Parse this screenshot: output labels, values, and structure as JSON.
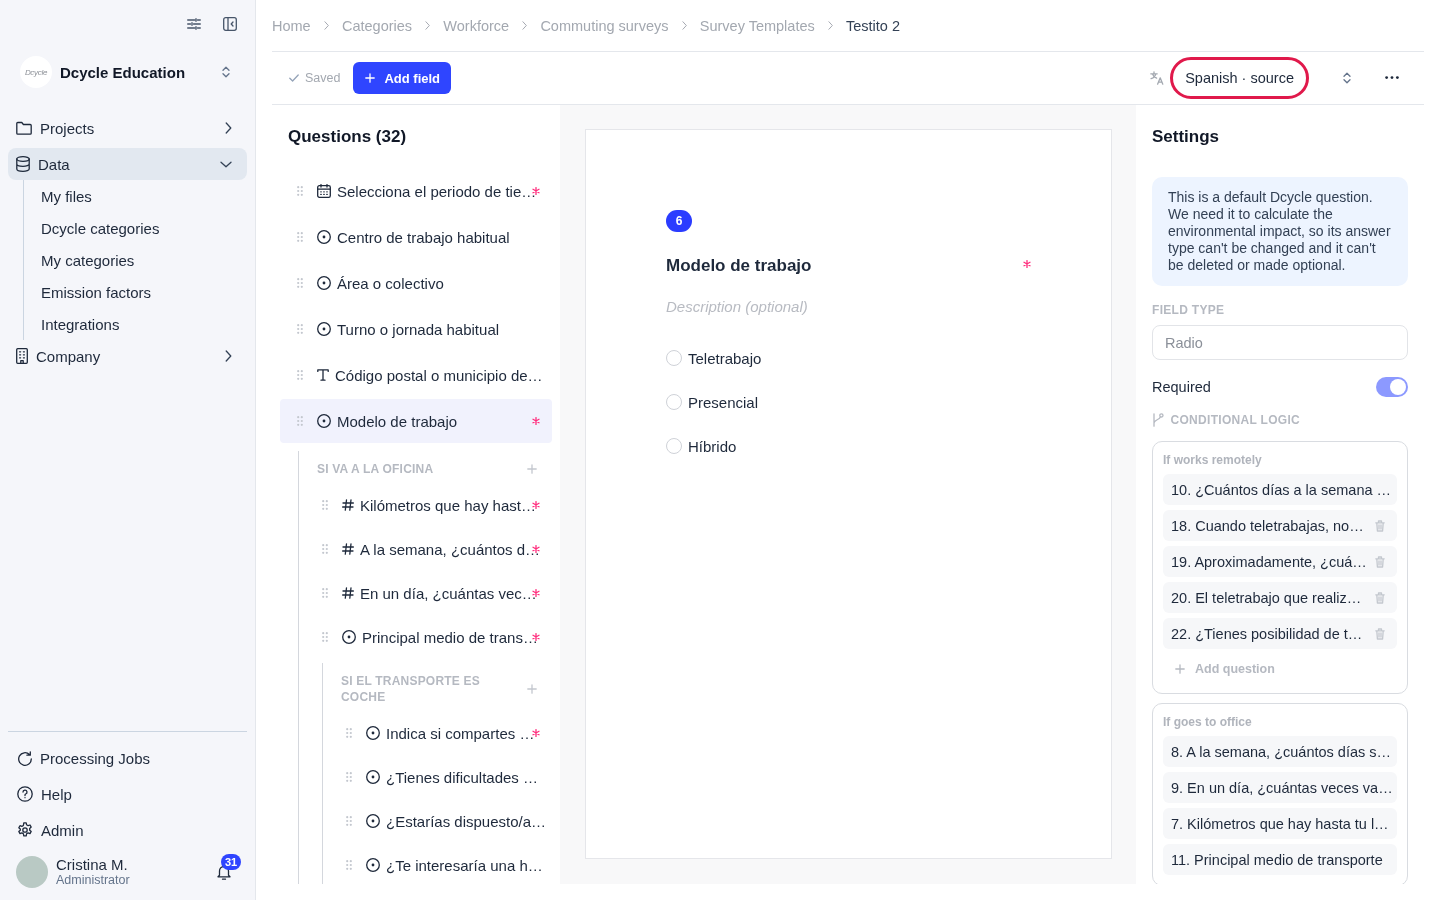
{
  "sidebar": {
    "org": {
      "logo_text": "Dcycle",
      "name": "Dcycle Education"
    },
    "nav": [
      {
        "label": "Projects",
        "kind": "folder",
        "selected": false,
        "expanded": false
      },
      {
        "label": "Data",
        "kind": "database",
        "selected": true,
        "expanded": true,
        "children": [
          {
            "label": "My files",
            "selected": false
          },
          {
            "label": "Dcycle categories",
            "selected": false
          },
          {
            "label": "My categories",
            "selected": false
          },
          {
            "label": "Emission factors",
            "selected": false
          },
          {
            "label": "Integrations",
            "selected": false
          }
        ]
      },
      {
        "label": "Company",
        "kind": "building",
        "selected": false,
        "expanded": false
      }
    ],
    "footer_nav": [
      {
        "label": "Processing Jobs",
        "kind": "refresh"
      },
      {
        "label": "Help",
        "kind": "help"
      },
      {
        "label": "Admin",
        "kind": "settings"
      }
    ],
    "user": {
      "name": "Cristina M.",
      "role": "Administrator",
      "notifications": "31"
    }
  },
  "breadcrumb": [
    {
      "label": "Home",
      "current": false
    },
    {
      "label": "Categories",
      "current": false
    },
    {
      "label": "Workforce",
      "current": false
    },
    {
      "label": "Commuting surveys",
      "current": false
    },
    {
      "label": "Survey Templates",
      "current": false
    },
    {
      "label": "Testito 2",
      "current": true
    }
  ],
  "toolbar": {
    "status": "Saved",
    "add_button": "Add field",
    "language": {
      "label": "Spanish · source",
      "highlighted": true
    }
  },
  "questions": {
    "title": "Questions (32)",
    "items": [
      {
        "label": "Selecciona el periodo de tie…",
        "kind": "date",
        "required": true,
        "selected": false
      },
      {
        "label": "Centro de trabajo habitual",
        "kind": "choice",
        "required": false,
        "selected": false
      },
      {
        "label": "Área o colectivo",
        "kind": "choice",
        "required": false,
        "selected": false
      },
      {
        "label": "Turno o jornada habitual",
        "kind": "choice",
        "required": false,
        "selected": false
      },
      {
        "label": "Código postal o municipio de…",
        "kind": "text",
        "required": false,
        "selected": false
      },
      {
        "label": "Modelo de trabajo",
        "kind": "choice",
        "required": true,
        "selected": true,
        "branches": [
          {
            "title": "SI VA A LA OFICINA",
            "children": [
              {
                "label": "Kilómetros que hay hast…",
                "kind": "number",
                "required": true,
                "selected": false
              },
              {
                "label": "A la semana, ¿cuántos d…",
                "kind": "number",
                "required": true,
                "selected": false
              },
              {
                "label": "En un día, ¿cuántas vec…",
                "kind": "number",
                "required": true,
                "selected": false
              },
              {
                "label": "Principal medio de trans…",
                "kind": "choice",
                "required": true,
                "selected": false,
                "branches": [
                  {
                    "title": "SI EL TRANSPORTE ES COCHE",
                    "children": [
                      {
                        "label": "Indica si compartes …",
                        "kind": "choice",
                        "required": true,
                        "selected": false
                      },
                      {
                        "label": "¿Tienes dificultades …",
                        "kind": "choice",
                        "required": false,
                        "selected": false
                      },
                      {
                        "label": "¿Estarías dispuesto/a…",
                        "kind": "choice",
                        "required": false,
                        "selected": false
                      },
                      {
                        "label": "¿Te interesaría una h…",
                        "kind": "choice",
                        "required": false,
                        "selected": false
                      }
                    ]
                  }
                ]
              }
            ]
          }
        ]
      }
    ]
  },
  "preview": {
    "number": "6",
    "title": "Modelo de trabajo",
    "required": true,
    "description": {
      "placeholder": "Description (optional)"
    },
    "options": [
      {
        "label": "Teletrabajo",
        "selected": false
      },
      {
        "label": "Presencial",
        "selected": false
      },
      {
        "label": "Híbrido",
        "selected": false
      }
    ]
  },
  "settings": {
    "title": "Settings",
    "notice": "This is a default Dcycle question. We need it to calculate the environmental impact, so its answer type can't be changed and it can't be deleted or made optional.",
    "field_type": {
      "label": "FIELD TYPE",
      "value": "Radio",
      "disabled": true
    },
    "required": {
      "label": "Required",
      "on": true
    },
    "conditional_logic": {
      "label": "CONDITIONAL LOGIC",
      "rules": [
        {
          "title": "If works remotely",
          "items": [
            {
              "label": "10. ¿Cuántos días a la semana …",
              "deletable": false
            },
            {
              "label": "18. Cuando teletrabajas, no…",
              "deletable": true
            },
            {
              "label": "19. Aproximadamente, ¿cuá…",
              "deletable": true
            },
            {
              "label": "20. El teletrabajo que realiz…",
              "deletable": true
            },
            {
              "label": "22. ¿Tienes posibilidad de t…",
              "deletable": true
            }
          ],
          "add_label": "Add question"
        },
        {
          "title": "If goes to office",
          "items": [
            {
              "label": "8. A la semana, ¿cuántos días s…",
              "deletable": false
            },
            {
              "label": "9. En un día, ¿cuántas veces va…",
              "deletable": false
            },
            {
              "label": "7. Kilómetros que hay hasta tu l…",
              "deletable": false
            },
            {
              "label": "11. Principal medio de transporte",
              "deletable": false
            }
          ]
        }
      ]
    }
  }
}
